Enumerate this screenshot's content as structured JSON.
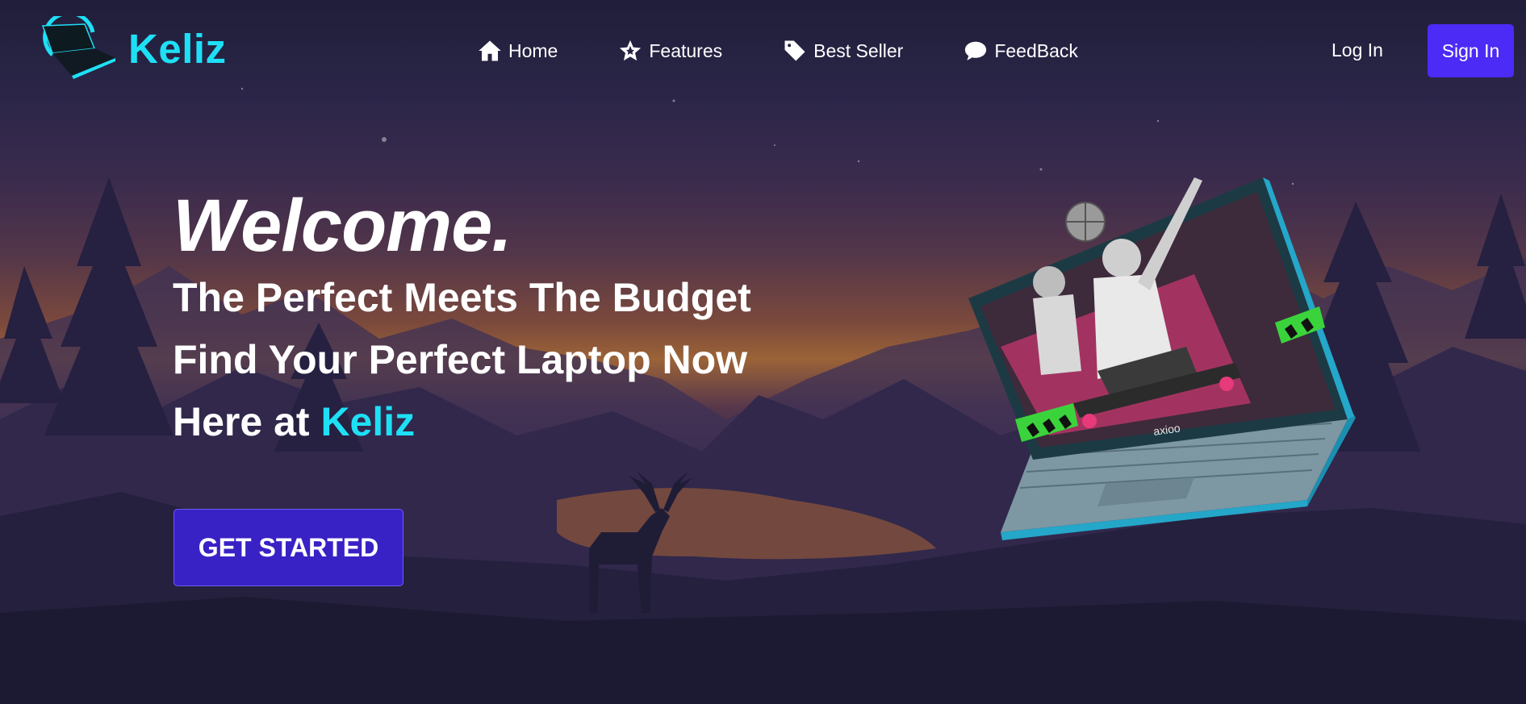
{
  "brand": {
    "name": "Keliz",
    "accent": "#1ee0f5"
  },
  "nav": {
    "items": [
      {
        "label": "Home",
        "icon": "home-icon"
      },
      {
        "label": "Features",
        "icon": "star-icon"
      },
      {
        "label": "Best Seller",
        "icon": "tag-icon"
      },
      {
        "label": "FeedBack",
        "icon": "chat-bubble-icon"
      }
    ]
  },
  "auth": {
    "login_label": "Log In",
    "signin_label": "Sign In",
    "signin_color": "#4b2bf5"
  },
  "hero": {
    "welcome": "Welcome.",
    "line1": "The Perfect Meets The Budget",
    "line2": "Find Your Perfect Laptop Now",
    "line3_prefix": "Here at ",
    "line3_brand": "Keliz",
    "cta_label": "GET STARTED",
    "cta_color": "#3822c5"
  },
  "product": {
    "laptop_logo_text": "axioo"
  }
}
